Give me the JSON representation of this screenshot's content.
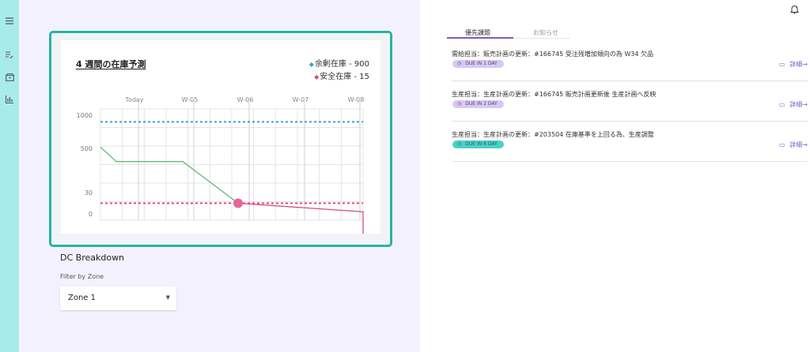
{
  "nav": {
    "icons": [
      "menu-icon",
      "list-edit-icon",
      "box-icon",
      "bar-chart-icon"
    ]
  },
  "forecast": {
    "title": "4 週間の在庫予測",
    "legend": [
      {
        "label": "余剰在庫 - 900",
        "color": "#3aa0d8"
      },
      {
        "label": "安全在庫 - 15",
        "color": "#d84b86"
      }
    ]
  },
  "chart_data": {
    "type": "line",
    "title": "4 週間の在庫予測",
    "x_ticks": [
      "Today",
      "W-05",
      "W-06",
      "W-07",
      "W-08"
    ],
    "y_ticks": [
      "1000",
      "500",
      "30",
      "0"
    ],
    "series": [
      {
        "name": "余剰在庫 - 900",
        "values": [
          {
            "x": 0,
            "y": 900
          }
        ],
        "style": "dashed",
        "color": "#3aa0d8"
      },
      {
        "name": "安全在庫 - 15",
        "values": [
          {
            "x": 0,
            "y": 15
          }
        ],
        "style": "dashed",
        "color": "#d84b86"
      },
      {
        "name": "forecast_green",
        "values": [
          {
            "x": -0.7,
            "y": 520
          },
          {
            "x": -0.4,
            "y": 360
          },
          {
            "x": 0.8,
            "y": 360
          },
          {
            "x": 1.8,
            "y": 15
          }
        ],
        "color": "#5dbb7b"
      },
      {
        "name": "forecast_pink",
        "values": [
          {
            "x": 1.8,
            "y": 15
          },
          {
            "x": 4.1,
            "y": 3
          },
          {
            "x": 4.3,
            "y": -40
          }
        ],
        "color": "#d84b86"
      }
    ],
    "marker": {
      "x": 1.8,
      "y": 15,
      "color": "#e8629c"
    },
    "grid": true,
    "legend_position": "top-right"
  },
  "breakdown": {
    "title": "DC Breakdown",
    "filter_label": "Filter by Zone",
    "zone_value": "Zone 1"
  },
  "tabs": [
    {
      "label": "優先課題",
      "active": true
    },
    {
      "label": "お知らせ",
      "active": false
    }
  ],
  "tasks": [
    {
      "text": "需給担当：販売計画の更新：#166745 受注残増加傾向の為 W34 欠品",
      "due": "DUE IN 1 DAY",
      "badge_color": "#d9c8f5",
      "action": "詳細→"
    },
    {
      "text": "生産担当：生産計画の更新：#166745 販売計画更新後 生産計画へ反映",
      "due": "DUE IN 2 DAY",
      "badge_color": "#d9c8f5",
      "action": "詳細→"
    },
    {
      "text": "生産担当：生産計画の更新：#203504 在庫基準を上回る為、生産調整",
      "due": "DUE IN 8 DAY",
      "badge_color": "#46d3c8",
      "action": "詳細→"
    }
  ]
}
